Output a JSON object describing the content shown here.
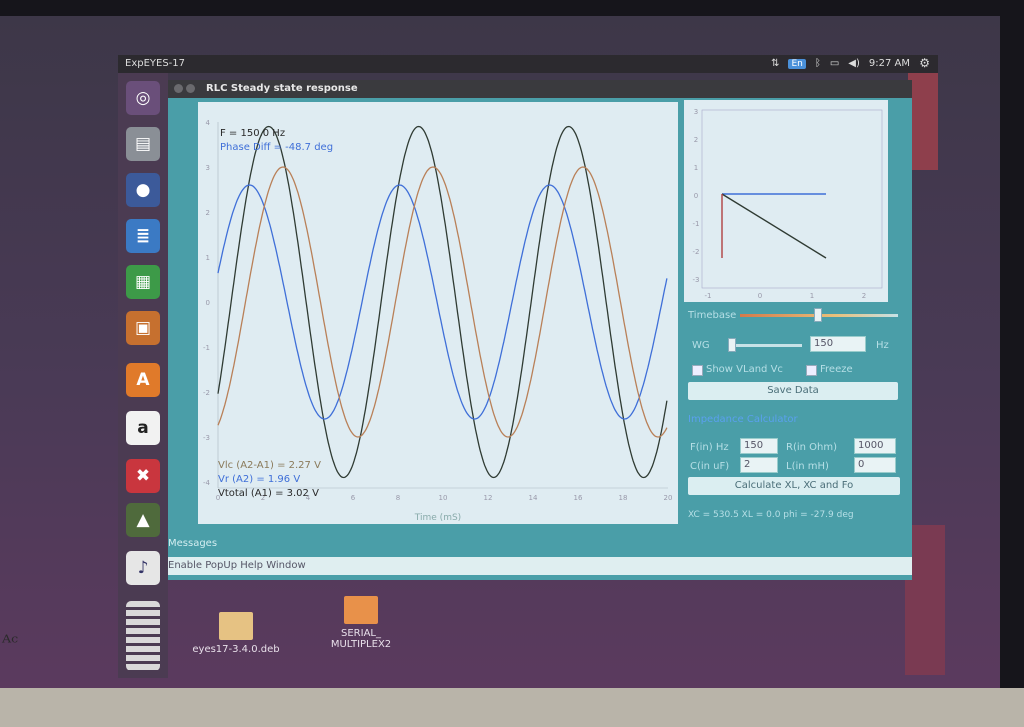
{
  "panel": {
    "title": "ExpEYES-17",
    "keyboard": "En",
    "time": "9:27 AM"
  },
  "window": {
    "title": "RLC Steady state response"
  },
  "plot": {
    "freq_label": "F = 150.0 Hz",
    "phase_label": "Phase Diff = -48.7 deg",
    "vlc_label": "Vlc (A2-A1) = 2.27 V",
    "vr_label": "Vr (A2) = 1.96 V",
    "vtotal_label": "Vtotal (A1) = 3.02 V",
    "xlabel": "Time (mS)",
    "yticks": [
      "4",
      "3",
      "2",
      "1",
      "0",
      "-1",
      "-2",
      "-3",
      "-4"
    ],
    "xticks": [
      "0",
      "2",
      "4",
      "6",
      "8",
      "10",
      "12",
      "14",
      "16",
      "18",
      "20"
    ],
    "colors": {
      "vlc": "#2f3b33",
      "vr": "#3f6fd8",
      "vtotal": "#b98058",
      "bg": "#dfecf2"
    }
  },
  "small_plot": {
    "yticks": [
      "3",
      "2",
      "1",
      "0",
      "-1",
      "-2",
      "-3"
    ],
    "xticks": [
      "-1",
      "0",
      "1",
      "2",
      "3"
    ]
  },
  "controls": {
    "timebase_label": "Timebase",
    "wg_label": "WG",
    "wg_value": "150",
    "wg_unit": "Hz",
    "show_vl_vc_label": "Show VLand Vc",
    "freeze_label": "Freeze",
    "save_button": "Save Data",
    "impedance_title": "Impedance Calculator",
    "f_label": "F(in) Hz",
    "f_value": "150",
    "r_label": "R(in Ohm)",
    "r_value": "1000",
    "c_label": "C(in uF)",
    "c_value": "2",
    "l_label": "L(in mH)",
    "l_value": "0",
    "calc_button": "Calculate XL, XC and Fo",
    "result_text": "XC = 530.5  XL = 0.0  phi = -27.9 deg"
  },
  "messages_label": "Messages",
  "help_label": "Enable PopUp Help Window",
  "desktop": {
    "item1": "eyes17-3.4.0.deb",
    "item2_line1": "SERIAL_",
    "item2_line2": "MULTIPLEX2"
  },
  "launcher_icons": [
    "ubuntu-icon",
    "files-icon",
    "firefox-icon",
    "writer-icon",
    "calc-icon",
    "impress-icon",
    "software-center-icon",
    "amazon-icon",
    "settings-icon",
    "update-icon",
    "expeyes-icon",
    "workspace-icon"
  ]
}
